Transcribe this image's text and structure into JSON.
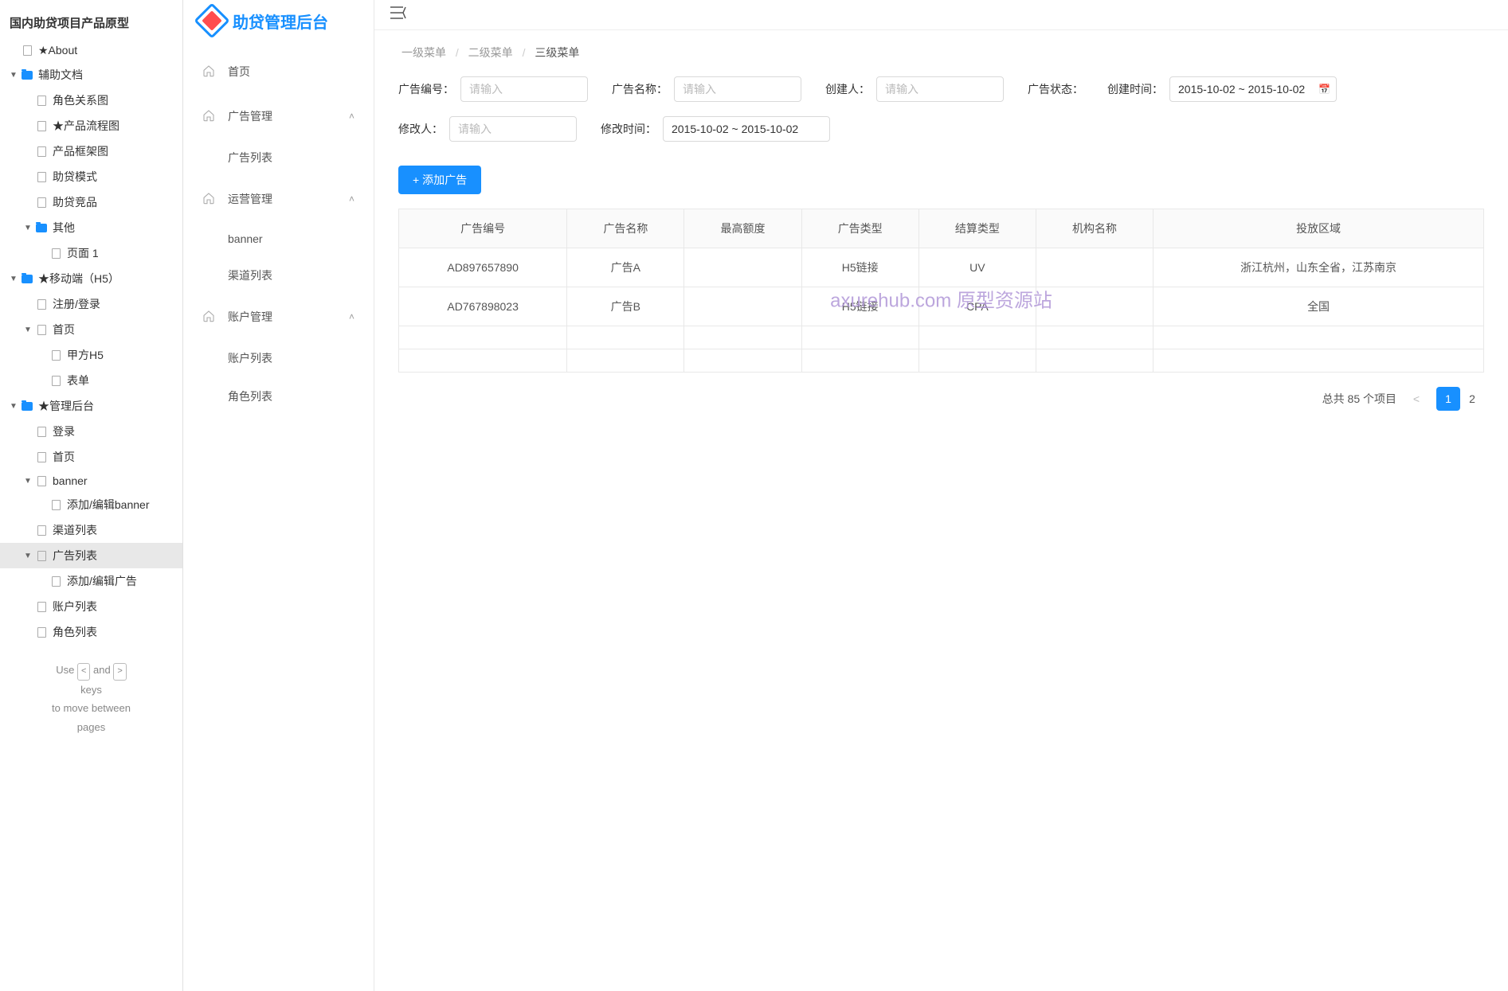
{
  "tree": {
    "title": "国内助贷项目产品原型",
    "nodes": [
      {
        "label": "★About",
        "type": "page",
        "indent": 0
      },
      {
        "label": "辅助文档",
        "type": "folder",
        "indent": 0,
        "expanded": true
      },
      {
        "label": "角色关系图",
        "type": "page",
        "indent": 1
      },
      {
        "label": "★产品流程图",
        "type": "page",
        "indent": 1
      },
      {
        "label": "产品框架图",
        "type": "page",
        "indent": 1
      },
      {
        "label": "助贷模式",
        "type": "page",
        "indent": 1
      },
      {
        "label": "助贷竞品",
        "type": "page",
        "indent": 1
      },
      {
        "label": "其他",
        "type": "folder",
        "indent": 1,
        "expanded": true
      },
      {
        "label": "页面 1",
        "type": "page",
        "indent": 2
      },
      {
        "label": "★移动端（H5）",
        "type": "folder",
        "indent": 0,
        "expanded": true
      },
      {
        "label": "注册/登录",
        "type": "page",
        "indent": 1
      },
      {
        "label": "首页",
        "type": "page",
        "indent": 1,
        "expanded": true,
        "hasChildren": true
      },
      {
        "label": "甲方H5",
        "type": "page",
        "indent": 2
      },
      {
        "label": "表单",
        "type": "page",
        "indent": 2
      },
      {
        "label": "★管理后台",
        "type": "folder",
        "indent": 0,
        "expanded": true
      },
      {
        "label": "登录",
        "type": "page",
        "indent": 1
      },
      {
        "label": "首页",
        "type": "page",
        "indent": 1
      },
      {
        "label": "banner",
        "type": "page",
        "indent": 1,
        "expanded": true,
        "hasChildren": true
      },
      {
        "label": "添加/编辑banner",
        "type": "page",
        "indent": 2
      },
      {
        "label": "渠道列表",
        "type": "page",
        "indent": 1
      },
      {
        "label": "广告列表",
        "type": "page",
        "indent": 1,
        "expanded": true,
        "hasChildren": true,
        "active": true
      },
      {
        "label": "添加/编辑广告",
        "type": "page",
        "indent": 2
      },
      {
        "label": "账户列表",
        "type": "page",
        "indent": 1
      },
      {
        "label": "角色列表",
        "type": "page",
        "indent": 1
      }
    ],
    "hint": {
      "use": "Use",
      "and": "and",
      "keys": "keys",
      "move": "to move between",
      "pages": "pages"
    }
  },
  "app": {
    "title": "助贷管理后台",
    "nav": [
      {
        "label": "首页",
        "children": []
      },
      {
        "label": "广告管理",
        "children": [
          "广告列表"
        ]
      },
      {
        "label": "运营管理",
        "children": [
          "banner",
          "渠道列表"
        ]
      },
      {
        "label": "账户管理",
        "children": [
          "账户列表",
          "角色列表"
        ]
      }
    ]
  },
  "breadcrumb": [
    "一级菜单",
    "二级菜单",
    "三级菜单"
  ],
  "filters": {
    "ad_id": {
      "label": "广告编号：",
      "placeholder": "请输入"
    },
    "ad_name": {
      "label": "广告名称：",
      "placeholder": "请输入"
    },
    "creator": {
      "label": "创建人：",
      "placeholder": "请输入"
    },
    "ad_status": {
      "label": "广告状态："
    },
    "create_time": {
      "label": "创建时间：",
      "value": "2015-10-02 ~ 2015-10-02"
    },
    "modifier": {
      "label": "修改人：",
      "placeholder": "请输入"
    },
    "modify_time": {
      "label": "修改时间：",
      "value": "2015-10-02 ~ 2015-10-02"
    }
  },
  "add_button": "+ 添加广告",
  "table": {
    "headers": [
      "广告编号",
      "广告名称",
      "最高额度",
      "广告类型",
      "结算类型",
      "机构名称",
      "投放区域"
    ],
    "rows": [
      [
        "AD897657890",
        "广告A",
        "",
        "H5链接",
        "UV",
        "",
        "浙江杭州，山东全省，江苏南京"
      ],
      [
        "AD767898023",
        "广告B",
        "",
        "H5链接",
        "CPA",
        "",
        "全国"
      ],
      [
        "",
        "",
        "",
        "",
        "",
        "",
        ""
      ],
      [
        "",
        "",
        "",
        "",
        "",
        "",
        ""
      ]
    ]
  },
  "watermark": "axurehub.com 原型资源站",
  "pagination": {
    "total_text": "总共 85 个项目",
    "pages": [
      "1",
      "2"
    ],
    "active": 0
  }
}
